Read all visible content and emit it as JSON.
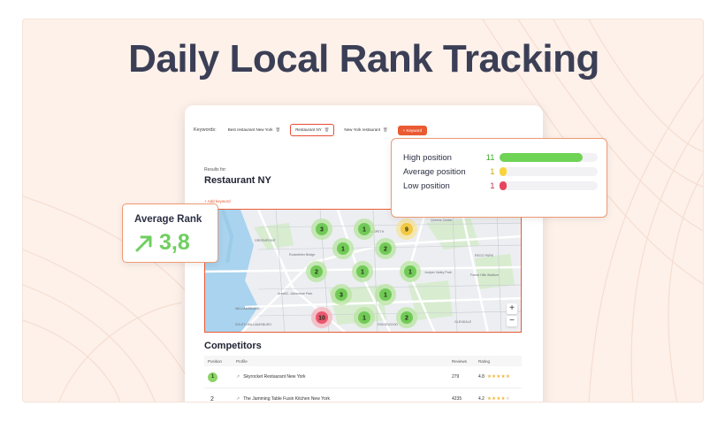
{
  "headline": "Daily Local Rank Tracking",
  "app": {
    "keywords_label": "Keywords:",
    "keywords": [
      {
        "label": "Best restaurant New York",
        "active": false
      },
      {
        "label": "Restaurant NY",
        "active": true
      },
      {
        "label": "New York restaurant",
        "active": false
      }
    ],
    "add_keyword_button": "+ Keyword",
    "results_for_label": "Results for:",
    "results_keyword": "Restaurant NY",
    "add_keyword_link": "+ Add keyword",
    "map": {
      "place_labels": [
        "GREENPOINT",
        "Rockefeller Bridge",
        "MASPETH",
        "Queens Center",
        "REGO PARK",
        "Forest Hills Stadium",
        "Juniper Valley Park",
        "Area53 - Adventure Park",
        "WILLIAMSBURG",
        "SOUTH WILLIAMSBURG",
        "RIDGEWOOD",
        "GLENDALE"
      ],
      "rank_pins": [
        {
          "rank": "3",
          "level": "high"
        },
        {
          "rank": "1",
          "level": "high"
        },
        {
          "rank": "9",
          "level": "average"
        },
        {
          "rank": "1",
          "level": "high"
        },
        {
          "rank": "2",
          "level": "high"
        },
        {
          "rank": "2",
          "level": "high"
        },
        {
          "rank": "1",
          "level": "high"
        },
        {
          "rank": "1",
          "level": "high"
        },
        {
          "rank": "3",
          "level": "high"
        },
        {
          "rank": "1",
          "level": "high"
        },
        {
          "rank": "10",
          "level": "low"
        },
        {
          "rank": "1",
          "level": "high"
        },
        {
          "rank": "2",
          "level": "high"
        }
      ],
      "zoom_in": "+",
      "zoom_out": "−"
    },
    "competitors_title": "Competitors",
    "competitors_columns": [
      "Position",
      "Profile",
      "Reviews",
      "Rating"
    ],
    "competitors": [
      {
        "position": "1",
        "profile": "Skyrocket Restaurant New York",
        "reviews": "279",
        "rating": "4.8",
        "stars": 5
      },
      {
        "position": "2",
        "profile": "The Jamming Table Fusin Kitchen New York",
        "reviews": "4235",
        "rating": "4.2",
        "stars": 4
      }
    ]
  },
  "average_rank": {
    "title": "Average Rank",
    "value": "3,8",
    "trend_icon": "arrow-up-right-icon"
  },
  "positions": [
    {
      "label": "High position",
      "count": "11",
      "share": 0.85,
      "color": "#6fd356"
    },
    {
      "label": "Average position",
      "count": "1",
      "share": 0.08,
      "color": "#f7d43c"
    },
    {
      "label": "Low position",
      "count": "1",
      "share": 0.08,
      "color": "#e8435e"
    }
  ],
  "colors": {
    "brand": "#ea5b33",
    "heading": "#3b3f56",
    "high": "#6fd356",
    "average": "#f7d43c",
    "low": "#e8435e"
  }
}
